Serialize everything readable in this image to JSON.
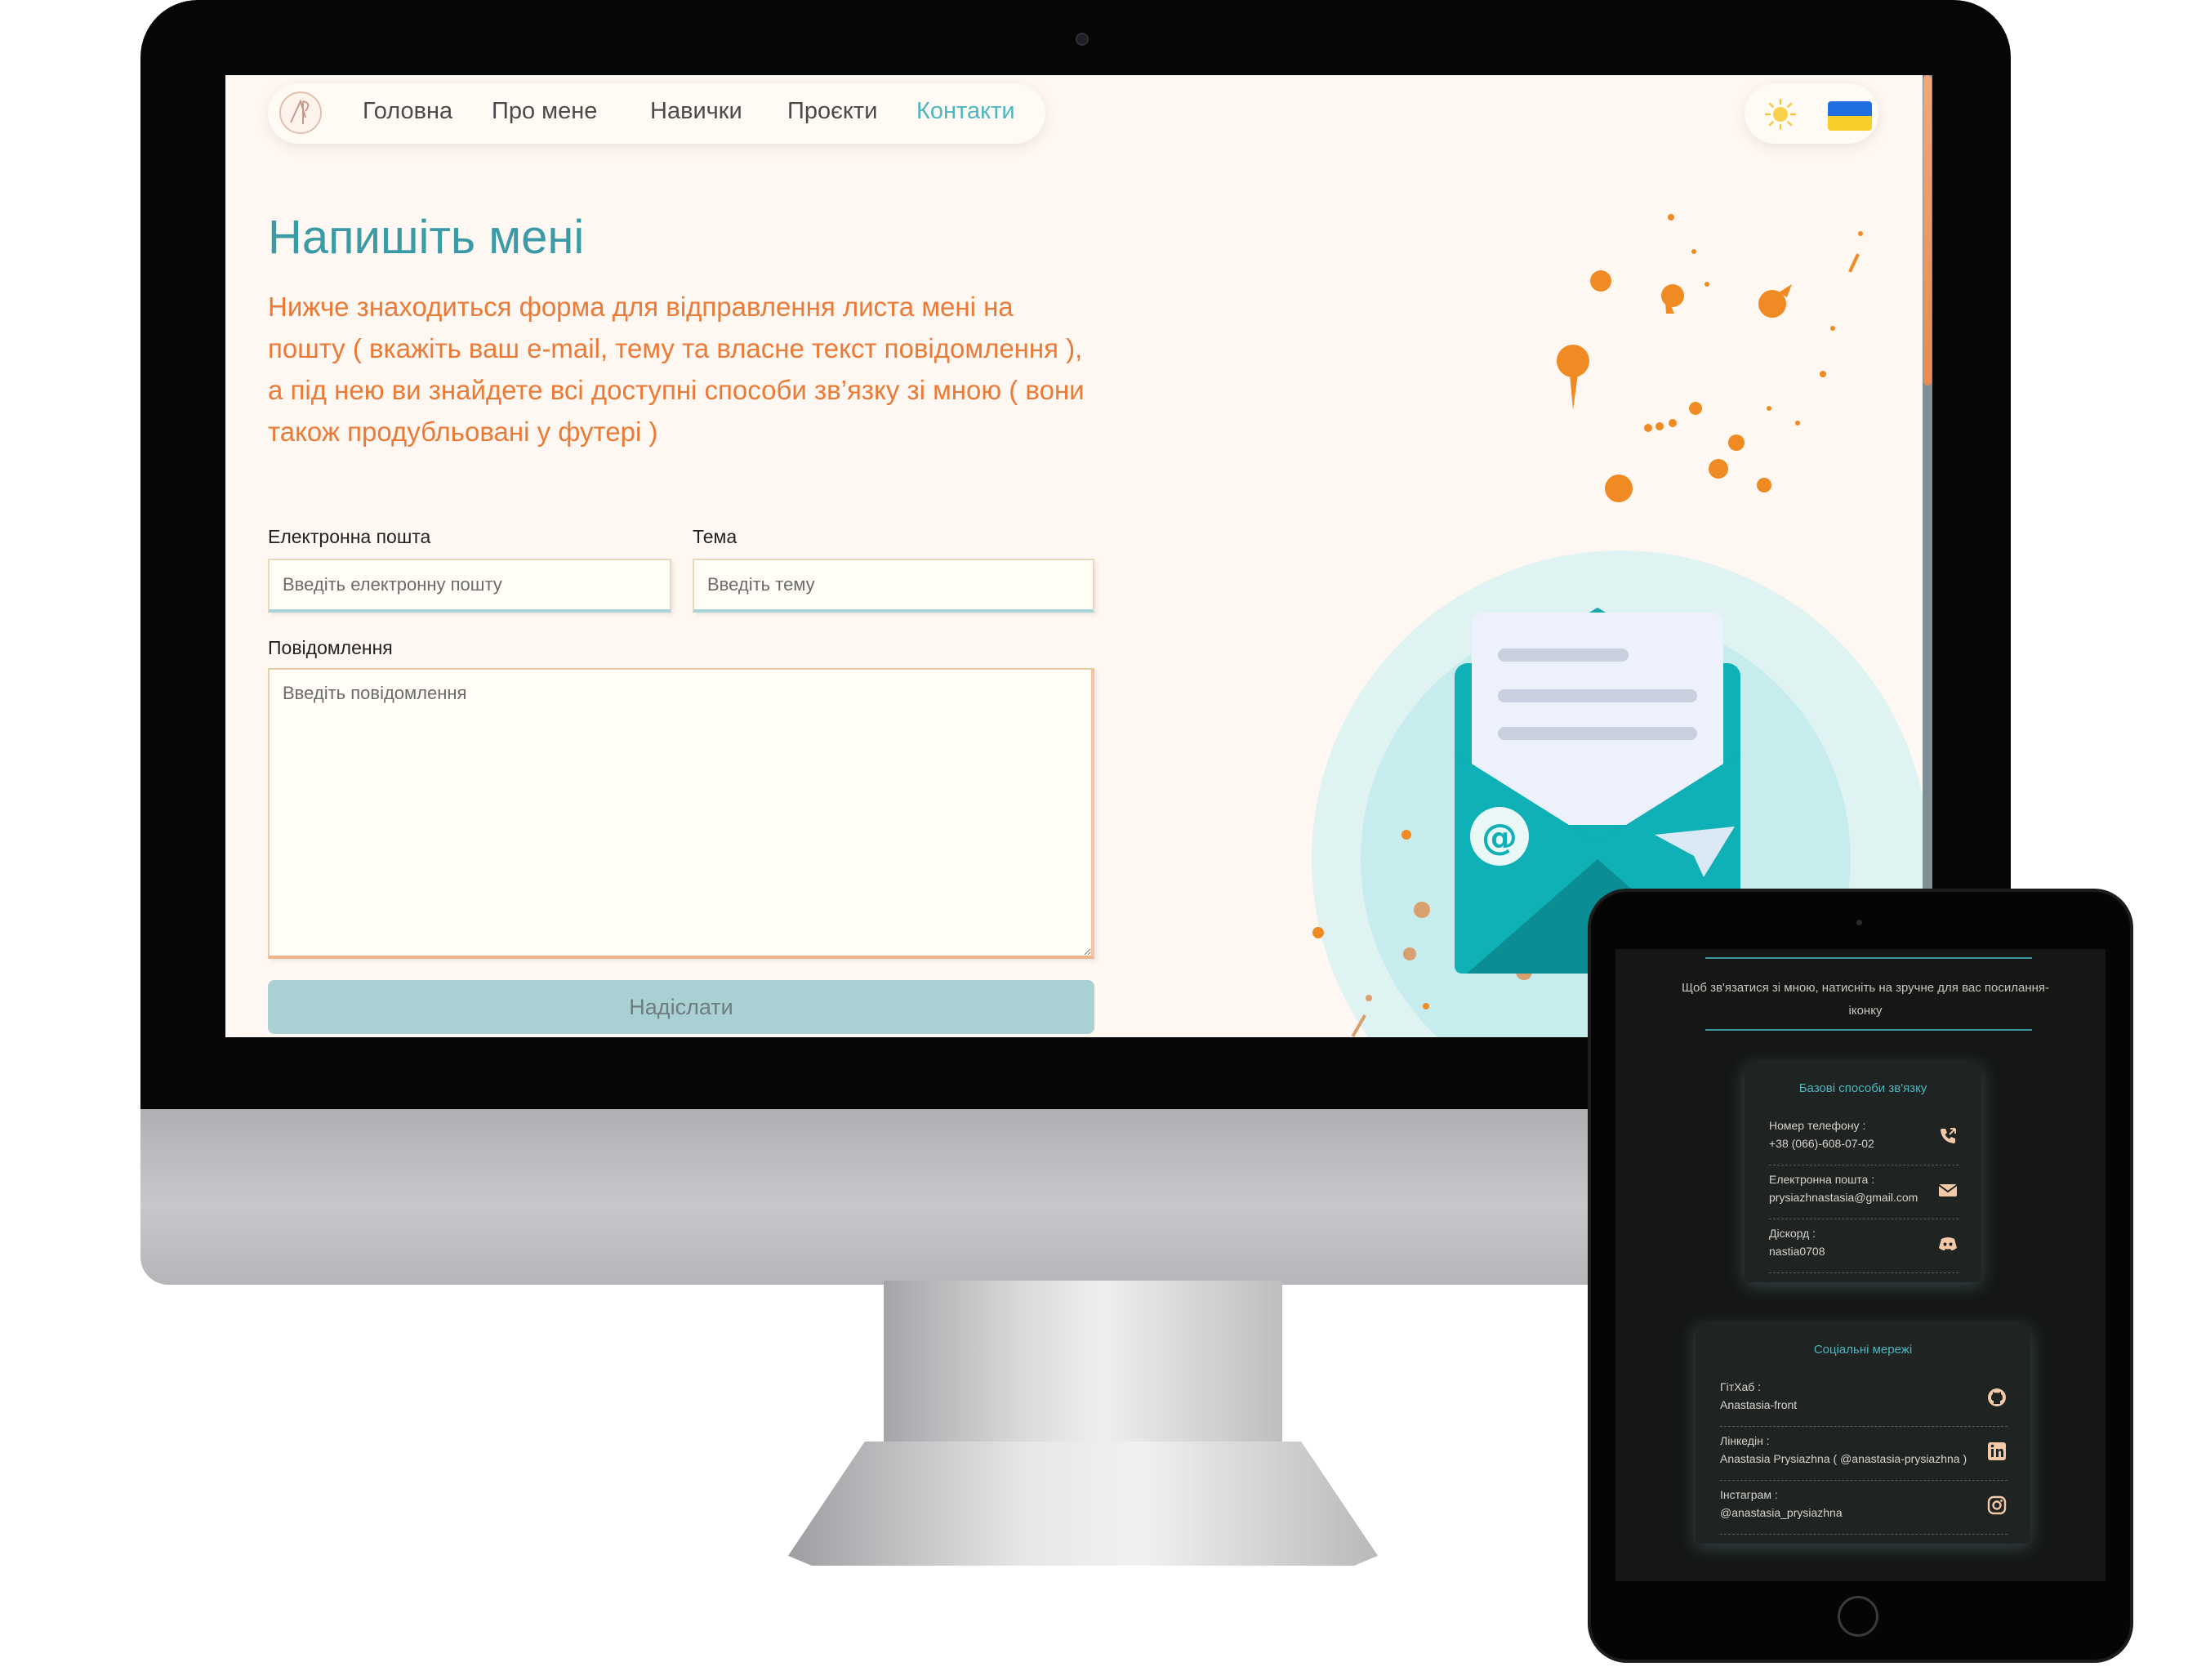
{
  "nav": {
    "items": [
      {
        "label": "Головна",
        "active": false
      },
      {
        "label": "Про мене",
        "active": false
      },
      {
        "label": "Навички",
        "active": false
      },
      {
        "label": "Проєкти",
        "active": false
      },
      {
        "label": "Контакти",
        "active": true
      }
    ],
    "theme_icon": "sun-icon",
    "language_icon": "ukraine-flag-icon"
  },
  "page": {
    "title": "Напишіть мені",
    "intro": "Нижче знаходиться форма для відправлення листа мені на пошту ( вкажіть ваш e-mail, тему та власне текст повідомлення ), а під нею ви знайдете всі доступні способи зв’язку зі мною ( вони також продубльовані у футері )"
  },
  "form": {
    "email": {
      "label": "Електронна пошта",
      "placeholder": "Введіть електронну пошту",
      "value": ""
    },
    "subject": {
      "label": "Тема",
      "placeholder": "Введіть тему",
      "value": ""
    },
    "message": {
      "label": "Повідомлення",
      "placeholder": "Введіть повідомлення",
      "value": ""
    },
    "submit_label": "Надіслати"
  },
  "tablet": {
    "hint": "Щоб зв'язатися зі мною, натисніть на зручне для вас посилання-іконку",
    "basic": {
      "title": "Базові способи зв'язку",
      "items": [
        {
          "label": "Номер телефону :",
          "value": "+38 (066)-608-07-02",
          "icon": "phone-icon"
        },
        {
          "label": "Електронна пошта :",
          "value": "prysiazhnastasia@gmail.com",
          "icon": "mail-icon"
        },
        {
          "label": "Діскорд :",
          "value": "nastia0708",
          "icon": "discord-icon"
        }
      ]
    },
    "social": {
      "title": "Соціальні мережі",
      "items": [
        {
          "label": "ГітХаб :",
          "value": "Anastasia-front",
          "icon": "github-icon"
        },
        {
          "label": "Лінкедін :",
          "value": "Anastasia Prysiazhna ( @anastasia-prysiazhna )",
          "icon": "linkedin-icon"
        },
        {
          "label": "Інстаграм :",
          "value": "@anastasia_prysiazhna",
          "icon": "instagram-icon"
        }
      ]
    }
  },
  "colors": {
    "accent_teal": "#4fb6bf",
    "accent_orange": "#ec7a36",
    "page_background": "#fff8f2",
    "submit_button": "#a9d1d4",
    "tablet_background": "#151716",
    "tablet_icon": "#f3c9a8"
  }
}
